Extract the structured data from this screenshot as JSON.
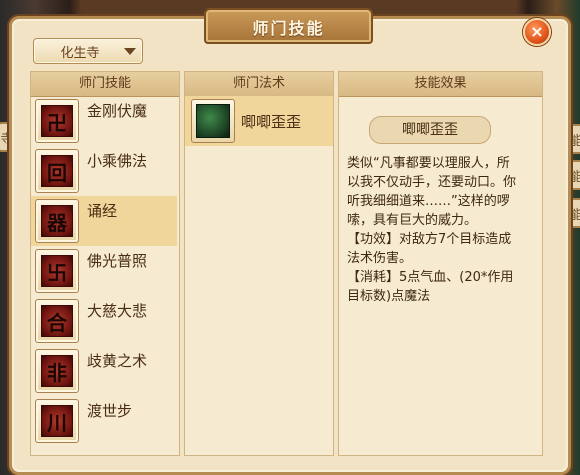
{
  "window": {
    "title": "师门技能",
    "close_symbol": "×"
  },
  "school_select": {
    "value": "化生寺"
  },
  "columns": {
    "skills_header": "师门技能",
    "methods_header": "师门法术",
    "effect_header": "技能效果"
  },
  "skills": [
    {
      "label": "金刚伏魔",
      "icon": "skill-emblem-icon",
      "glyph": "卍",
      "selected": false
    },
    {
      "label": "小乘佛法",
      "icon": "skill-emblem-icon",
      "glyph": "回",
      "selected": false
    },
    {
      "label": "诵经",
      "icon": "skill-emblem-icon",
      "glyph": "器",
      "selected": true
    },
    {
      "label": "佛光普照",
      "icon": "skill-emblem-icon",
      "glyph": "卐",
      "selected": false
    },
    {
      "label": "大慈大悲",
      "icon": "skill-emblem-icon",
      "glyph": "合",
      "selected": false
    },
    {
      "label": "歧黄之术",
      "icon": "skill-emblem-icon",
      "glyph": "非",
      "selected": false
    },
    {
      "label": "渡世步",
      "icon": "skill-emblem-icon",
      "glyph": "川",
      "selected": false
    }
  ],
  "methods": [
    {
      "label": "唧唧歪歪",
      "icon": "spell-green-icon",
      "selected": true
    }
  ],
  "effect": {
    "name": "唧唧歪歪",
    "lines": [
      "类似“凡事都要以理服人，所",
      "以我不仅动手，还要动口。你",
      "听我细细道来……”这样的啰",
      "嗦，具有巨大的威力。",
      "【功效】对敌方7个目标造成",
      "法术伤害。",
      "【消耗】5点气血、(20*作用",
      "目标数)点魔法"
    ]
  },
  "background": {
    "side_buttons": [
      "能",
      "能",
      "能",
      "寺",
      "能"
    ]
  },
  "colors": {
    "panel": "#f1e3c4",
    "selected_row": "#f0d69a",
    "title_bar": "#a87438",
    "close_button": "#e0541a"
  }
}
